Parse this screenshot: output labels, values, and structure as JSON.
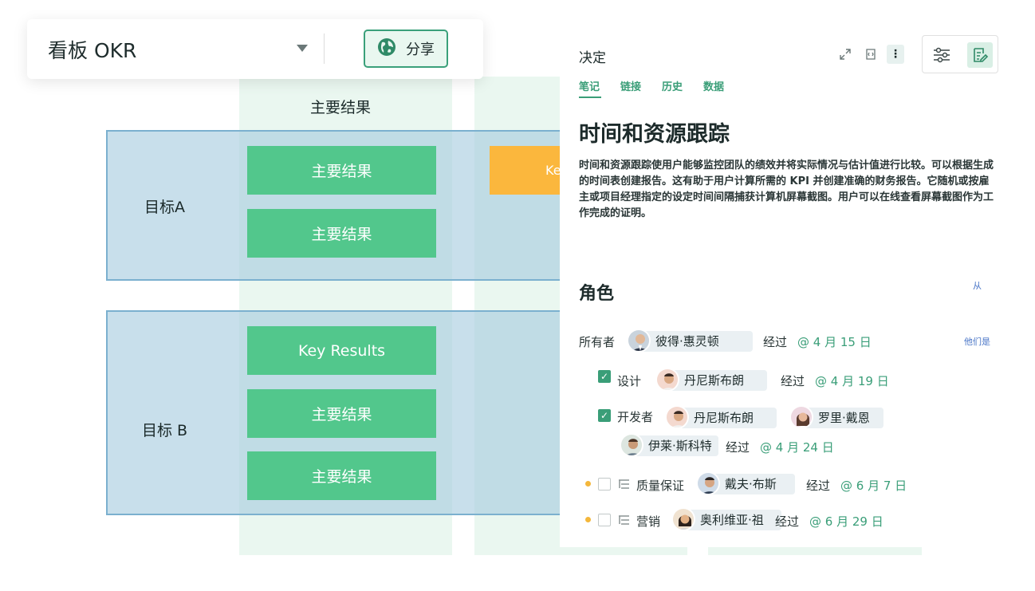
{
  "board": {
    "title": "看板 OKR",
    "share_label": "分享",
    "column_header": "主要结果",
    "rows": [
      {
        "label": "目标A",
        "cards": [
          "主要结果",
          "主要结果"
        ],
        "orange_card": "Ke"
      },
      {
        "label": "目标 B",
        "cards": [
          "Key Results",
          "主要结果",
          "主要结果"
        ]
      }
    ]
  },
  "panel": {
    "title": "决定",
    "tabs": [
      "笔记",
      "链接",
      "历史",
      "数据"
    ],
    "active_tab": "笔记",
    "heading": "时间和资源跟踪",
    "description": "时间和资源跟踪使用户能够监控团队的绩效并将实际情况与估计值进行比较。可以根据生成的时间表创建报告。这有助于用户计算所需的 KPI 并创建准确的财务报告。它随机或按雇主或项目经理指定的设定时间间隔捕获计算机屏幕截图。用户可以在线查看屏幕截图作为工作完成的证明。",
    "roles_heading": "角色",
    "from_link": "从",
    "they_link": "他们是",
    "owner": {
      "label": "所有者",
      "person": "彼得·惠灵顿",
      "via": "经过",
      "date": "@ 4 月 15 日"
    },
    "design": {
      "label": "设计",
      "person": "丹尼斯布朗",
      "via": "经过",
      "date": "@ 4 月 19 日",
      "checked": true
    },
    "developer": {
      "label": "开发者",
      "people": [
        "丹尼斯布朗",
        "罗里·戴恩",
        "伊莱·斯科特"
      ],
      "via": "经过",
      "date": "@ 4 月 24 日",
      "checked": true
    },
    "qa": {
      "label": "质量保证",
      "person": "戴夫·布斯",
      "via": "经过",
      "date": "@ 6 月 7 日",
      "checked": false
    },
    "marketing": {
      "label": "营销",
      "person": "奥利维亚·祖",
      "via": "经过",
      "date": "@ 6 月 29 日",
      "checked": false
    }
  },
  "colors": {
    "accent": "#3a9e78",
    "card_green": "#52c78c",
    "card_orange": "#fbb73d",
    "row_band": "#a6ccde",
    "column_band": "#eaf7f0",
    "link_blue": "#4a76c7",
    "status_dot": "#f4b73b"
  },
  "icons": [
    "caret-down-icon",
    "globe-icon",
    "expand-icon",
    "embed-icon",
    "more-icon",
    "filter-icon",
    "edit-notes-icon",
    "checkbox-icon",
    "subtask-icon"
  ]
}
